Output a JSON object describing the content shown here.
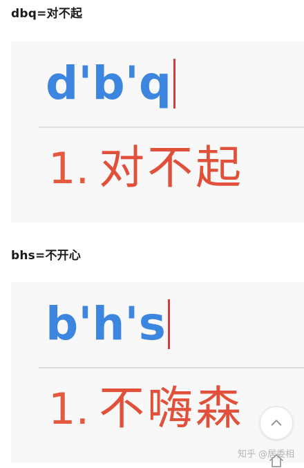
{
  "examples": [
    {
      "caption": "dbq=对不起",
      "input": "d'b'q",
      "candidate_index": "1.",
      "candidate_text": "对不起"
    },
    {
      "caption": "bhs=不开心",
      "input": "b'h's",
      "candidate_index": "1.",
      "candidate_text": "不嗨森"
    }
  ],
  "watermark": "知乎 @居委相",
  "icons": {
    "back_to_top": "chevron-up-icon",
    "home": "home-icon"
  },
  "colors": {
    "input_text": "#3d86df",
    "caret": "#d63a3a",
    "candidate_text": "#e0503a"
  }
}
